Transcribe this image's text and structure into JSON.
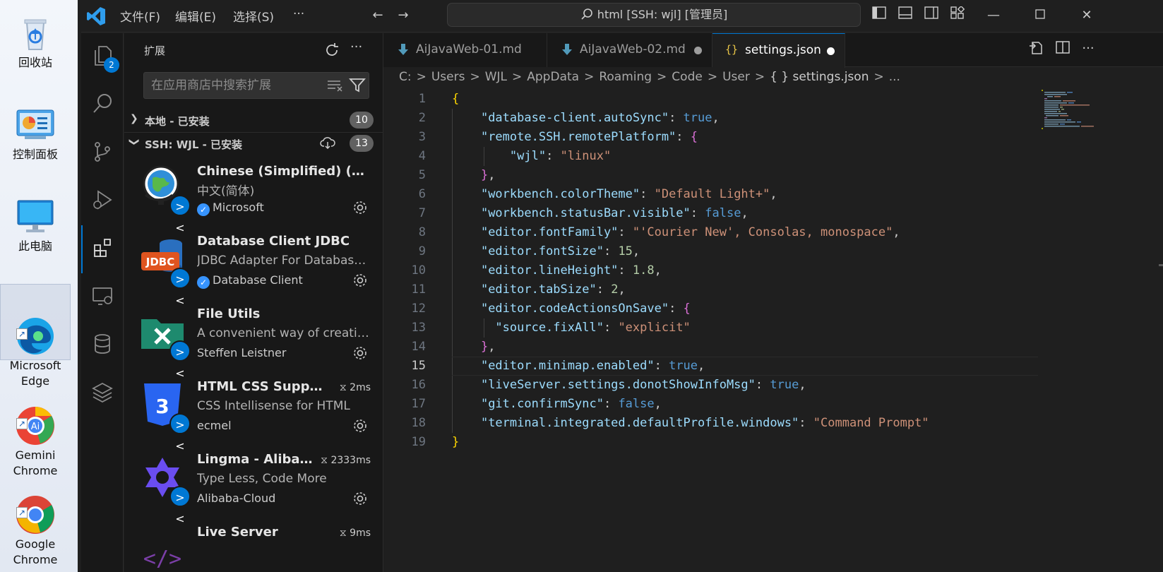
{
  "desktop": {
    "icons": [
      {
        "label": "回收站"
      },
      {
        "label": "控制面板"
      },
      {
        "label": "此电脑"
      },
      {
        "label": "Microsoft\nEdge"
      },
      {
        "label": "Gemini\nChrome"
      },
      {
        "label": "Google\nChrome"
      }
    ]
  },
  "titlebar": {
    "menus": [
      "文件(F)",
      "编辑(E)",
      "选择(S)",
      "···"
    ],
    "command_center": "html [SSH: wjl] [管理员]"
  },
  "activity": {
    "explorer_badge": "2"
  },
  "sidebar": {
    "title": "扩展",
    "search_placeholder": "在应用商店中搜索扩展",
    "sections": [
      {
        "label": "本地 - 已安装",
        "count": "10"
      },
      {
        "label": "SSH: WJL - 已安装",
        "count": "13"
      }
    ],
    "extensions": [
      {
        "name": "Chinese (Simplified) (简体中文) Language Pack",
        "desc": "中文(简体)",
        "publisher": "Microsoft",
        "verified": true,
        "time": ""
      },
      {
        "name": "Database Client JDBC",
        "desc": "JDBC Adapter For Database Client",
        "publisher": "Database Client",
        "verified": true,
        "time": ""
      },
      {
        "name": "File Utils",
        "desc": "A convenient way of creating files",
        "publisher": "Steffen Leistner",
        "verified": false,
        "time": ""
      },
      {
        "name": "HTML CSS Support",
        "desc": "CSS Intellisense for HTML",
        "publisher": "ecmel",
        "verified": false,
        "time": "2ms"
      },
      {
        "name": "Lingma - Alibaba Cloud AI Coding Assistant",
        "desc": "Type Less, Code More",
        "publisher": "Alibaba-Cloud",
        "verified": false,
        "time": "2333ms"
      },
      {
        "name": "Live Server",
        "desc": "",
        "publisher": "",
        "verified": false,
        "time": "9ms"
      }
    ]
  },
  "editor": {
    "tabs": [
      {
        "label": "AiJavaWeb-01.md",
        "dirty": false
      },
      {
        "label": "AiJavaWeb-02.md",
        "dirty": true
      },
      {
        "label": "settings.json",
        "dirty": true,
        "active": true
      }
    ],
    "breadcrumb": [
      "C:",
      "Users",
      "WJL",
      "AppData",
      "Roaming",
      "Code",
      "User",
      "{ } settings.json",
      "..."
    ],
    "current_line": 15,
    "lines": [
      {
        "n": "1"
      },
      {
        "n": "2"
      },
      {
        "n": "3"
      },
      {
        "n": "4"
      },
      {
        "n": "5"
      },
      {
        "n": "6"
      },
      {
        "n": "7"
      },
      {
        "n": "8"
      },
      {
        "n": "9"
      },
      {
        "n": "10"
      },
      {
        "n": "11"
      },
      {
        "n": "12"
      },
      {
        "n": "13"
      },
      {
        "n": "14"
      },
      {
        "n": "15"
      },
      {
        "n": "16"
      },
      {
        "n": "17"
      },
      {
        "n": "18"
      },
      {
        "n": "19"
      }
    ],
    "tokens": {
      "k_autosync": "\"database-client.autoSync\"",
      "k_remote": "\"remote.SSH.remotePlatform\"",
      "k_wjl": "\"wjl\"",
      "v_linux": "\"linux\"",
      "k_theme": "\"workbench.colorTheme\"",
      "v_theme": "\"Default Light+\"",
      "k_statusbar": "\"workbench.statusBar.visible\"",
      "k_fontfamily": "\"editor.fontFamily\"",
      "v_fontfamily": "\"'Courier New', Consolas, monospace\"",
      "k_fontsize": "\"editor.fontSize\"",
      "v_fontsize": "15",
      "k_lineheight": "\"editor.lineHeight\"",
      "v_lineheight": "1.8",
      "k_tabsize": "\"editor.tabSize\"",
      "v_tabsize": "2",
      "k_codeactions": "\"editor.codeActionsOnSave\"",
      "k_fixall": "\"source.fixAll\"",
      "v_explicit": "\"explicit\"",
      "k_minimap": "\"editor.minimap.enabled\"",
      "k_liveserver": "\"liveServer.settings.donotShowInfoMsg\"",
      "k_gitsync": "\"git.confirmSync\"",
      "k_terminal": "\"terminal.integrated.defaultProfile.windows\"",
      "v_terminal": "\"Command Prompt\"",
      "true": "true",
      "false": "false"
    }
  }
}
